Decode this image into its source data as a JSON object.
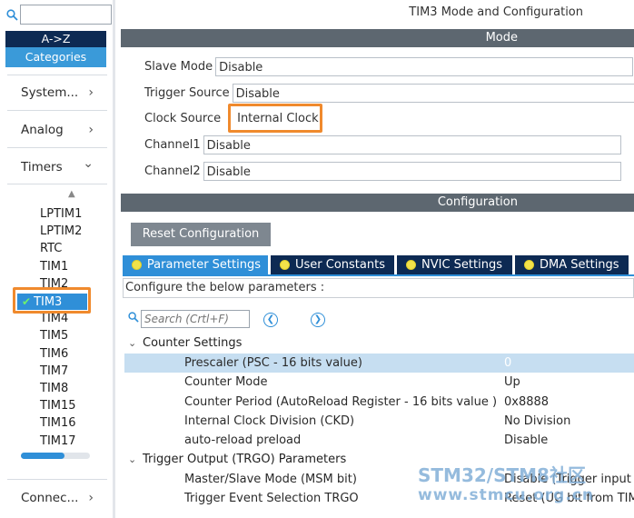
{
  "sidebar": {
    "search_placeholder": "",
    "sort_az_label": "A->Z",
    "sort_categories_label": "Categories",
    "categories": [
      {
        "label": "System...",
        "chevron": "›"
      },
      {
        "label": "Analog",
        "chevron": "›"
      },
      {
        "label": "Timers",
        "chevron": "⌄"
      },
      {
        "label": "Connec...",
        "chevron": "›"
      }
    ],
    "peripherals": [
      "LPTIM1",
      "LPTIM2",
      "RTC",
      "TIM1",
      "TIM2",
      "TIM3",
      "TIM4",
      "TIM5",
      "TIM6",
      "TIM7",
      "TIM8",
      "TIM15",
      "TIM16",
      "TIM17"
    ],
    "selected_peripheral": "TIM3",
    "check_glyph": "✔",
    "up_arrow_glyph": "▲"
  },
  "main": {
    "title": "TIM3 Mode and Configuration",
    "mode_header": "Mode",
    "mode_rows": [
      {
        "label": "Slave Mode",
        "value": "Disable"
      },
      {
        "label": "Trigger Source",
        "value": "Disable"
      },
      {
        "label": "Clock Source",
        "value": "Internal Clock"
      },
      {
        "label": "Channel1",
        "value": "Disable"
      },
      {
        "label": "Channel2",
        "value": "Disable"
      }
    ],
    "config_header": "Configuration",
    "reset_button": "Reset Configuration",
    "tabs": [
      {
        "label": "Parameter Settings",
        "active": true
      },
      {
        "label": "User Constants",
        "active": false
      },
      {
        "label": "NVIC Settings",
        "active": false
      },
      {
        "label": "DMA Settings",
        "active": false
      }
    ],
    "configure_text": "Configure the below parameters :",
    "search_placeholder": "Search (Crtl+F)",
    "prev_glyph": "❮",
    "next_glyph": "❯",
    "groups": [
      {
        "title": "Counter Settings",
        "chevron": "⌄",
        "params": [
          {
            "name": "Prescaler (PSC - 16 bits value)",
            "value": "0",
            "selected": true
          },
          {
            "name": "Counter Mode",
            "value": "Up"
          },
          {
            "name": "Counter Period (AutoReload Register - 16 bits value )",
            "value": "0x8888"
          },
          {
            "name": "Internal Clock Division (CKD)",
            "value": "No Division"
          },
          {
            "name": "auto-reload preload",
            "value": "Disable"
          }
        ]
      },
      {
        "title": "Trigger Output (TRGO) Parameters",
        "chevron": "⌄",
        "params": [
          {
            "name": "Master/Slave Mode (MSM bit)",
            "value": "Disable (Trigger input"
          },
          {
            "name": "Trigger Event Selection TRGO",
            "value": "Reset (UG bit from TIM"
          }
        ]
      }
    ]
  },
  "watermark": {
    "line1": "STM32/STM8社区",
    "line2": "www.stmcu.org.cn"
  },
  "colors": {
    "accent": "#2f8fd8",
    "dark_navy": "#0d2a53",
    "section_header": "#5d6770",
    "highlight_orange": "#f08a2d",
    "selected_row": "#c6def1"
  }
}
